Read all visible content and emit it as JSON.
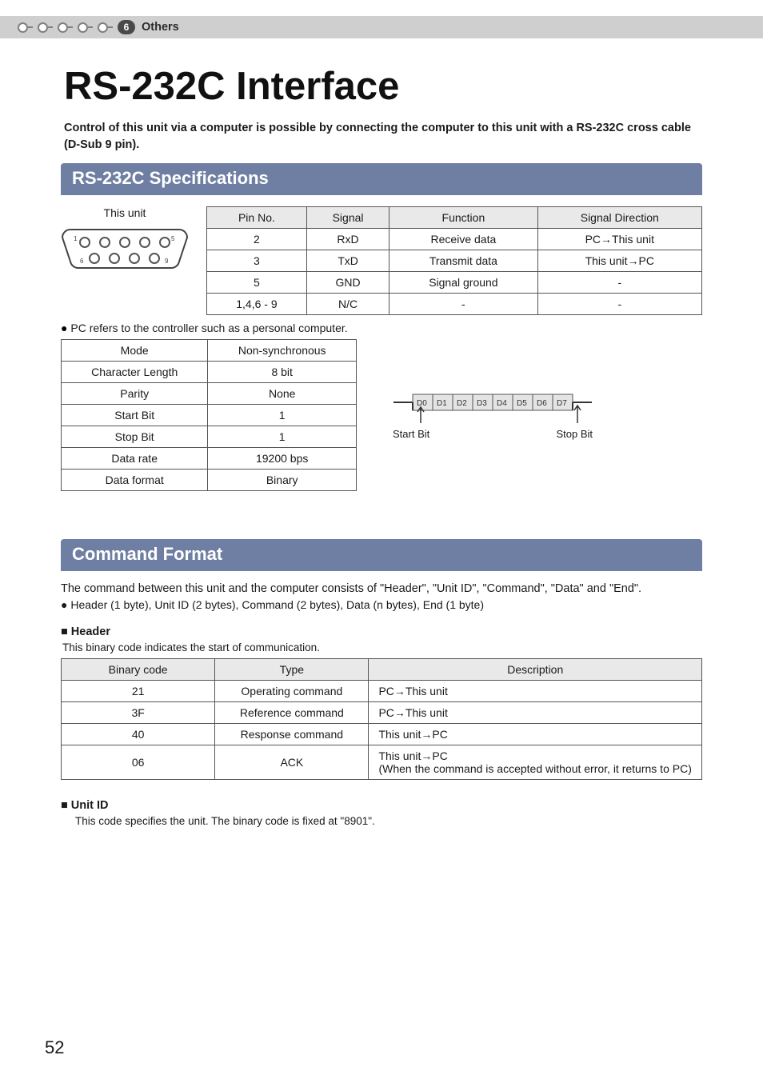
{
  "header": {
    "step_badge": "6",
    "category": "Others"
  },
  "title": "RS-232C Interface",
  "intro": "Control of this unit via a computer is possible by connecting the computer to this unit with a RS-232C cross cable (D-Sub 9 pin).",
  "sections": {
    "spec": {
      "title": "RS-232C Specifications",
      "unit_label": "This unit",
      "pin_headers": [
        "Pin No.",
        "Signal",
        "Function",
        "Signal Direction"
      ],
      "pin_rows": [
        [
          "2",
          "RxD",
          "Receive data",
          "PC→This unit"
        ],
        [
          "3",
          "TxD",
          "Transmit data",
          "This unit→PC"
        ],
        [
          "5",
          "GND",
          "Signal ground",
          "-"
        ],
        [
          "1,4,6 - 9",
          "N/C",
          "-",
          "-"
        ]
      ],
      "note": "PC refers to the controller such as a personal computer.",
      "mode_rows": [
        [
          "Mode",
          "Non-synchronous"
        ],
        [
          "Character Length",
          "8 bit"
        ],
        [
          "Parity",
          "None"
        ],
        [
          "Start Bit",
          "1"
        ],
        [
          "Stop Bit",
          "1"
        ],
        [
          "Data rate",
          "19200 bps"
        ],
        [
          "Data format",
          "Binary"
        ]
      ],
      "timing_bits": [
        "D0",
        "D1",
        "D2",
        "D3",
        "D4",
        "D5",
        "D6",
        "D7"
      ],
      "timing_start": "Start Bit",
      "timing_stop": "Stop Bit"
    },
    "cmd": {
      "title": "Command Format",
      "desc": "The command between this unit and the computer consists of \"Header\", \"Unit ID\", \"Command\", \"Data\" and \"End\".",
      "bullet": "Header (1 byte), Unit ID (2 bytes), Command (2 bytes), Data (n bytes), End (1 byte)",
      "header_sub": "Header",
      "header_note": "This binary code indicates the start of communication.",
      "header_headers": [
        "Binary code",
        "Type",
        "Description"
      ],
      "header_rows": [
        [
          "21",
          "Operating command",
          "PC→This unit"
        ],
        [
          "3F",
          "Reference command",
          "PC→This unit"
        ],
        [
          "40",
          "Response command",
          "This unit→PC"
        ],
        [
          "06",
          "ACK",
          "This unit→PC\n(When the command is accepted without error, it returns to PC)"
        ]
      ],
      "unitid_sub": "Unit ID",
      "unitid_note": "This code specifies the unit. The binary code is fixed at \"8901\"."
    }
  },
  "page_number": "52"
}
